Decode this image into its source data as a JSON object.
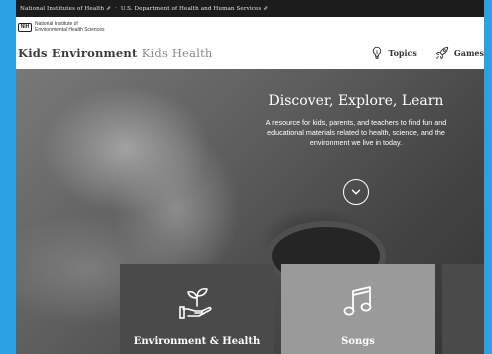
{
  "gov_bar": {
    "nih": "National Institutes of Health",
    "hhs": "U.S. Department of Health and Human Services"
  },
  "niehs": {
    "badge": "NIH",
    "line1": "National Institute of",
    "line2": "Environmental Health Sciences"
  },
  "site": {
    "title_a": "Kids Environment",
    "title_b": "Kids Health"
  },
  "nav": {
    "items": [
      {
        "label": "Topics",
        "icon": "lightbulb-icon"
      },
      {
        "label": "Games",
        "icon": "rocket-icon"
      }
    ]
  },
  "hero": {
    "title": "Discover, Explore, Learn",
    "subtitle": "A resource for kids, parents, and teachers to find fun and educational materials related to health, science, and the environment we live in today.",
    "scroll_icon": "chevron-down-icon"
  },
  "cards": [
    {
      "label": "Environment & Health",
      "icon": "plant-in-hand-icon"
    },
    {
      "label": "Songs",
      "icon": "music-note-icon"
    }
  ],
  "colors": {
    "frame": "#2aa1e0",
    "gov_bar": "#1c1c1c",
    "card_dark": "#4a4a4a",
    "card_light": "#9a9a9a"
  }
}
